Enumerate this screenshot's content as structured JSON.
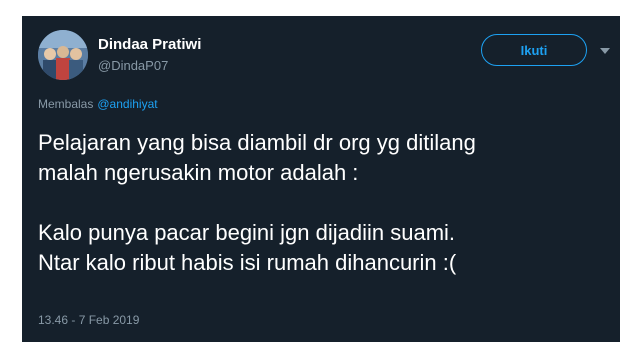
{
  "user": {
    "display_name": "Dindaa Pratiwi",
    "handle": "@DindaP07"
  },
  "header": {
    "follow_label": "Ikuti"
  },
  "reply": {
    "prefix": "Membalas",
    "mention": "@andihiyat"
  },
  "tweet": {
    "lines": [
      "Pelajaran yang bisa diambil dr org yg ditilang",
      "malah ngerusakin motor adalah :",
      "Kalo punya pacar begini jgn dijadiin suami.",
      "Ntar kalo ribut habis isi rumah dihancurin :("
    ],
    "timestamp": "13.46 - 7 Feb 2019"
  },
  "colors": {
    "background": "#15202b",
    "accent": "#1da1f2",
    "secondary_text": "#8899a6",
    "primary_text": "#ffffff"
  },
  "icons": {
    "caret": "chevron-down-icon"
  }
}
